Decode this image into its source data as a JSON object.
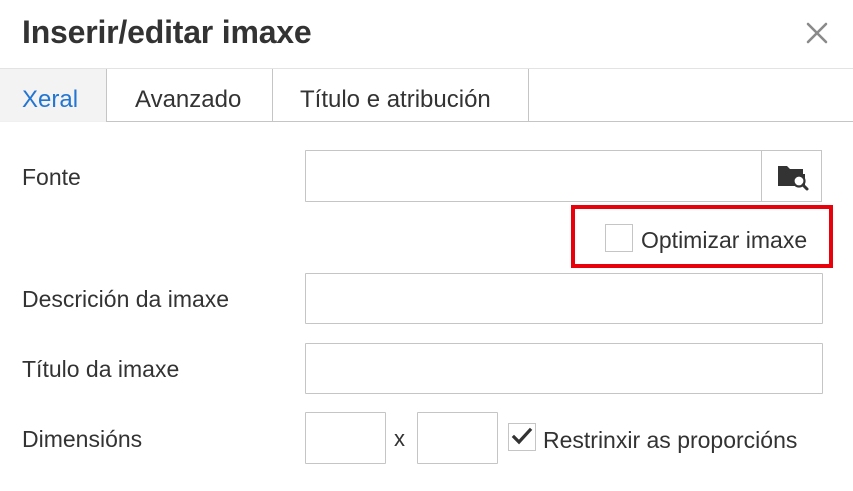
{
  "dialog": {
    "title": "Inserir/editar imaxe",
    "close_icon": "close-icon"
  },
  "tabs": [
    {
      "label": "Xeral",
      "active": true
    },
    {
      "label": "Avanzado",
      "active": false
    },
    {
      "label": "Título e atribución",
      "active": false
    }
  ],
  "form": {
    "source_label": "Fonte",
    "source_value": "",
    "browse_icon": "folder-search-icon",
    "optimize_label": "Optimizar imaxe",
    "optimize_checked": false,
    "description_label": "Descrición da imaxe",
    "description_value": "",
    "title_label": "Título da imaxe",
    "title_value": "",
    "dimensions_label": "Dimensións",
    "width_value": "",
    "height_value": "",
    "times_symbol": "x",
    "constrain_label": "Restrinxir as proporcións",
    "constrain_checked": true
  },
  "colors": {
    "active_tab": "#2276d2",
    "highlight": "#e8000b",
    "border": "#c5c5c5"
  }
}
